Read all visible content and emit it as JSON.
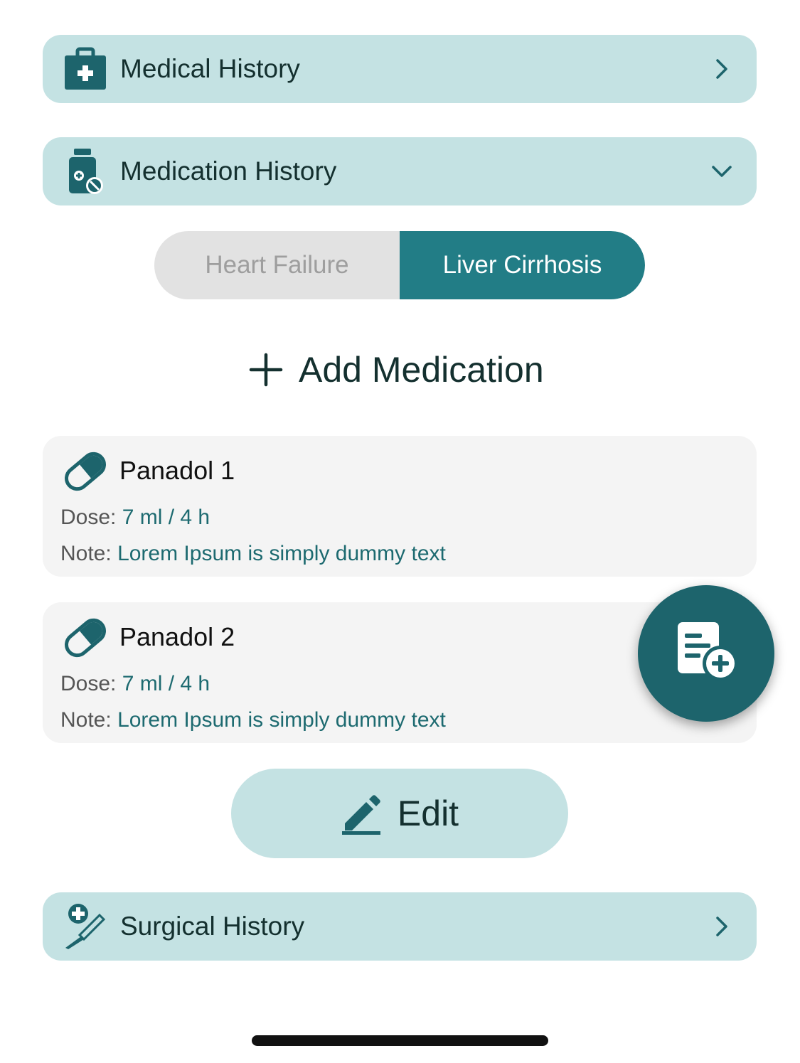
{
  "sections": {
    "medical": {
      "label": "Medical History",
      "icon": "medical-kit-icon"
    },
    "medication": {
      "label": "Medication History",
      "icon": "medicine-bottle-icon"
    },
    "surgical": {
      "label": "Surgical History",
      "icon": "scalpel-icon"
    }
  },
  "segments": [
    {
      "label": "Heart Failure",
      "selected": false
    },
    {
      "label": "Liver Cirrhosis",
      "selected": true
    }
  ],
  "add_medication": {
    "label": "Add Medication",
    "icon": "plus-icon"
  },
  "medications": [
    {
      "name": "Panadol 1",
      "dose_label": "Dose:",
      "dose": "7 ml / 4 h",
      "note_label": "Note:",
      "note": "Lorem Ipsum is simply dummy text"
    },
    {
      "name": "Panadol 2",
      "dose_label": "Dose:",
      "dose": "7 ml / 4 h",
      "note_label": "Note:",
      "note": "Lorem Ipsum is simply dummy text"
    }
  ],
  "edit_button": {
    "label": "Edit",
    "icon": "pencil-icon"
  },
  "fab": {
    "icon": "add-document-icon"
  },
  "colors": {
    "section_bg": "#c4e2e3",
    "accent": "#227d86",
    "dark_teal": "#1d646c",
    "card_bg": "#f4f4f4"
  }
}
